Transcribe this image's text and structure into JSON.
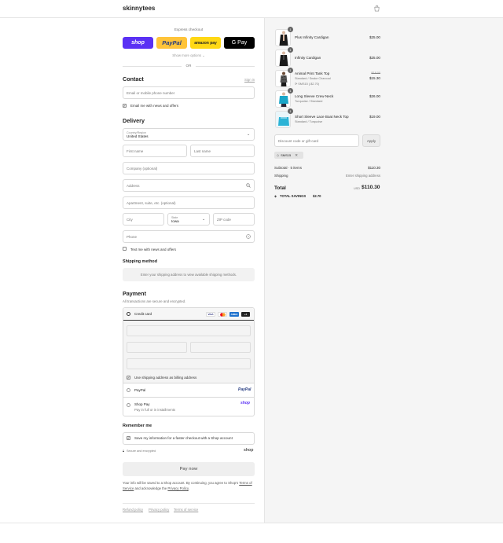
{
  "brand": "skinnytees",
  "express": {
    "title": "Express checkout",
    "buttons": [
      {
        "label": "shop",
        "color": "#5a31f4",
        "text_color": "#ffffff"
      },
      {
        "label": "PayPal",
        "color": "#ffc439",
        "text_color": "#253b80"
      },
      {
        "label": "amazon pay",
        "color": "#ffd814",
        "text_color": "#222222"
      },
      {
        "label": "G Pay",
        "color": "#000000",
        "text_color": "#ffffff"
      }
    ],
    "show_more": "Show more options ⌄",
    "or": "OR"
  },
  "contact": {
    "title": "Contact",
    "sign_in": "Sign in",
    "email_placeholder": "Email or mobile phone number",
    "news_label": "Email me with news and offers",
    "news_checked": true
  },
  "delivery": {
    "title": "Delivery",
    "country_label": "Country/Region",
    "country_value": "United States",
    "first_name": "First name",
    "last_name": "Last name",
    "company": "Company (optional)",
    "address": "Address",
    "apartment": "Apartment, suite, etc. (optional)",
    "city": "City",
    "state_label": "State",
    "state_value": "Iowa",
    "zip": "ZIP code",
    "phone": "Phone",
    "sms_label": "Text me with news and offers",
    "sms_checked": false
  },
  "shipping_method": {
    "title": "Shipping method",
    "message": "Enter your shipping address to view available shipping methods."
  },
  "payment": {
    "title": "Payment",
    "subtitle": "All transactions are secure and encrypted.",
    "credit_card_label": "Credit card",
    "card_badges": [
      "VISA",
      "MC",
      "AMEX",
      "+4"
    ],
    "billing_label": "Use shipping address as billing address",
    "billing_checked": true,
    "paypal_label": "PayPal",
    "paypal_logo": "PayPal",
    "shoppay_label": "Shop Pay",
    "shoppay_sub": "Pay in full or in installments",
    "shoppay_logo": "shop"
  },
  "remember": {
    "title": "Remember me",
    "save_label": "Save my information for a faster checkout with a Shop account",
    "save_checked": true,
    "secure": "Secure and encrypted",
    "shop_logo": "shop"
  },
  "pay_now": "Pay now",
  "legal": {
    "text": "Your info will be saved to a Shop account. By continuing, you agree to Shop's",
    "tos": "Terms of Service",
    "and": "and acknowledge the",
    "privacy": "Privacy Policy",
    "end": "."
  },
  "footer_links": [
    "Refund policy",
    "Privacy policy",
    "Terms of service"
  ],
  "cart": {
    "items": [
      {
        "qty": "1",
        "name": "Plus Infinity Cardigan",
        "variant": "",
        "discount": "",
        "original": "",
        "price": "$25.00",
        "icon": "black-cardigan"
      },
      {
        "qty": "1",
        "name": "Infinity Cardigan",
        "variant": "",
        "discount": "",
        "original": "",
        "price": "$25.00",
        "icon": "black-cardigan"
      },
      {
        "qty": "1",
        "name": "Animal Print Tank Top",
        "variant": "Standard / Snake Charcoal",
        "discount": "SMS15 (-$2.70)",
        "original": "$18.00",
        "price": "$15.30",
        "icon": "animal-print-top"
      },
      {
        "qty": "1",
        "name": "Long Sleeve Crew Neck",
        "variant": "Turquoise / Standard",
        "discount": "",
        "original": "",
        "price": "$26.00",
        "icon": "turquoise-top"
      },
      {
        "qty": "1",
        "name": "Short Sleeve Lace Boat Neck Top",
        "variant": "Standard / Turquoise",
        "discount": "",
        "original": "",
        "price": "$19.00",
        "icon": "turquoise-lace-top"
      }
    ],
    "discount_placeholder": "Discount code or gift card",
    "apply": "Apply",
    "applied_code": "SMS15",
    "subtotal_label": "Subtotal · 5 items",
    "subtotal_value": "$110.30",
    "shipping_label": "Shipping",
    "shipping_value": "Enter shipping address",
    "total_label": "Total",
    "currency": "USD",
    "total_value": "$110.30",
    "savings_label": "TOTAL SAVINGS",
    "savings_value": "$2.70"
  }
}
